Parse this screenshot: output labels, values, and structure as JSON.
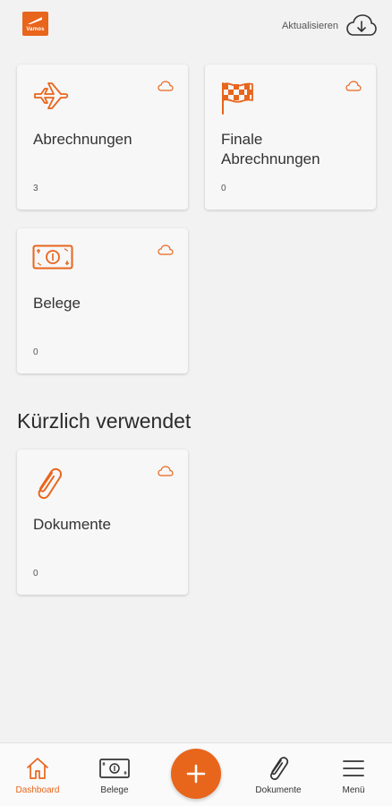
{
  "header": {
    "logo_text": "Vamos",
    "refresh_label": "Aktualisieren"
  },
  "cards": [
    {
      "title": "Abrechnungen",
      "count": "3",
      "icon": "airplane-icon"
    },
    {
      "title": "Finale Abrechnungen",
      "count": "0",
      "icon": "checkered-flag-icon"
    },
    {
      "title": "Belege",
      "count": "0",
      "icon": "banknote-icon"
    }
  ],
  "recent": {
    "section_title": "Kürzlich verwendet",
    "cards": [
      {
        "title": "Dokumente",
        "count": "0",
        "icon": "paperclip-icon"
      }
    ]
  },
  "nav": {
    "items": [
      {
        "label": "Dashboard",
        "icon": "home-icon",
        "active": true
      },
      {
        "label": "Belege",
        "icon": "banknote-icon",
        "active": false
      },
      {
        "label": "Dokumente",
        "icon": "paperclip-icon",
        "active": false
      },
      {
        "label": "Menü",
        "icon": "hamburger-menu-icon",
        "active": false
      }
    ],
    "fab_icon": "plus-icon"
  },
  "colors": {
    "accent": "#e8651c",
    "background": "#f2f2f2",
    "card": "#f7f7f7",
    "text": "#333333"
  }
}
